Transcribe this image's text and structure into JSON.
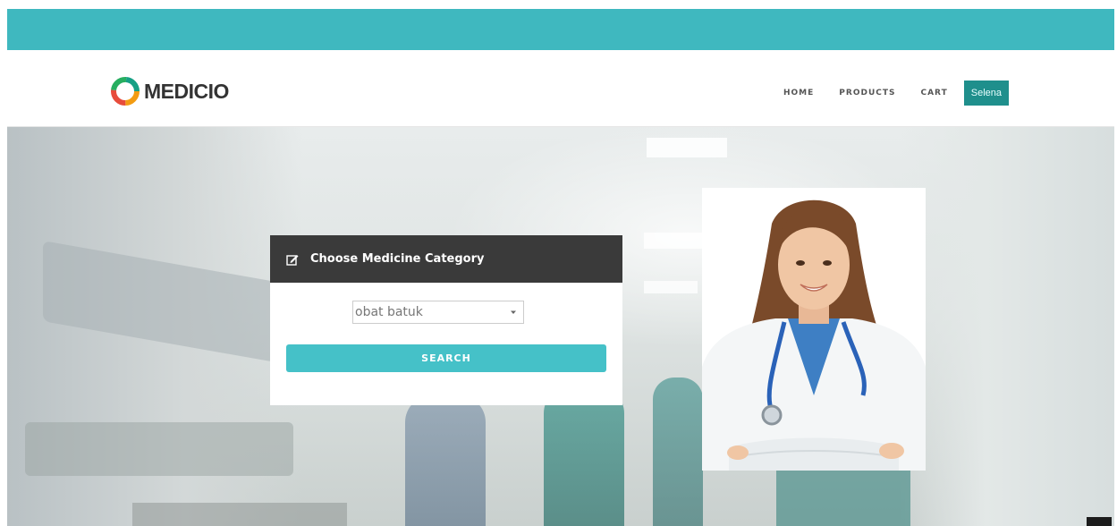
{
  "brand": {
    "name": "MEDICIO",
    "logo_icon": "medicio-ring-logo"
  },
  "nav": {
    "items": [
      {
        "label": "HOME"
      },
      {
        "label": "PRODUCTS"
      },
      {
        "label": "CART"
      }
    ],
    "user_label": "Selena"
  },
  "search_panel": {
    "title": "Choose Medicine Category",
    "title_icon": "edit-icon",
    "selected_category": "obat batuk",
    "button_label": "SEARCH"
  },
  "colors": {
    "topbar": "#3fb8bf",
    "accent": "#45c1c8",
    "user_badge": "#1f8f8c",
    "panel_header": "#3a3a3a"
  }
}
